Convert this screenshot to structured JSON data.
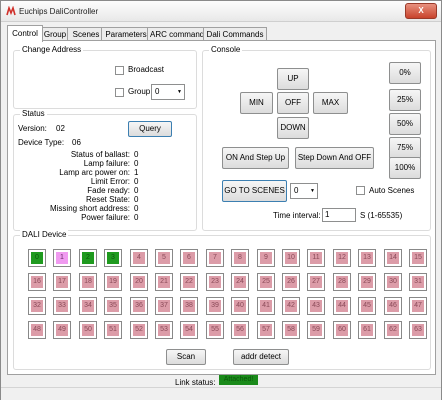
{
  "window": {
    "title": "Euchips DaliController",
    "close_label": "X"
  },
  "tabs": [
    "Control",
    "Group",
    "Scenes",
    "Parameters",
    "ARC command",
    "Dali Commands"
  ],
  "change_address": {
    "legend": "Change Address",
    "broadcast_label": "Broadcast",
    "group_label": "Group",
    "group_value": "0"
  },
  "status": {
    "legend": "Status",
    "version_label": "Version:",
    "version_value": "02",
    "device_type_label": "Device Type:",
    "device_type_value": "06",
    "query_label": "Query",
    "rows": [
      {
        "label": "Status of ballast:",
        "value": "0"
      },
      {
        "label": "Lamp failure:",
        "value": "0"
      },
      {
        "label": "Lamp arc power on:",
        "value": "1"
      },
      {
        "label": "Limit Error:",
        "value": "0"
      },
      {
        "label": "Fade ready:",
        "value": "0"
      },
      {
        "label": "Reset State:",
        "value": "0"
      },
      {
        "label": "Missing short address:",
        "value": "0"
      },
      {
        "label": "Power failure:",
        "value": "0"
      }
    ]
  },
  "console": {
    "legend": "Console",
    "up": "UP",
    "min": "MIN",
    "off": "OFF",
    "max": "MAX",
    "down": "DOWN",
    "on_step_up": "ON And Step Up",
    "step_down_off": "Step Down And OFF",
    "levels": [
      "0%",
      "25%",
      "50%",
      "75%",
      "100%"
    ],
    "go_to_scenes": "GO TO SCENES",
    "scene_value": "0",
    "auto_scenes_label": "Auto Scenes",
    "time_interval_label": "Time interval:",
    "time_interval_value": "1",
    "time_interval_unit": "S (1-65535)"
  },
  "dali": {
    "legend": "DALI Device",
    "devices": [
      "0",
      "1",
      "2",
      "3",
      "4",
      "5",
      "6",
      "7",
      "8",
      "9",
      "10",
      "11",
      "12",
      "13",
      "14",
      "15",
      "16",
      "17",
      "18",
      "19",
      "20",
      "21",
      "22",
      "23",
      "24",
      "25",
      "26",
      "27",
      "28",
      "29",
      "30",
      "31",
      "32",
      "33",
      "34",
      "35",
      "36",
      "37",
      "38",
      "39",
      "40",
      "41",
      "42",
      "43",
      "44",
      "45",
      "46",
      "47",
      "48",
      "49",
      "50",
      "51",
      "52",
      "53",
      "54",
      "55",
      "56",
      "57",
      "58",
      "59",
      "60",
      "61",
      "62",
      "63"
    ],
    "states": [
      "on",
      "sel",
      "on",
      "on",
      "off",
      "off",
      "off",
      "off",
      "off",
      "off",
      "off",
      "off",
      "off",
      "off",
      "off",
      "off",
      "off",
      "off",
      "off",
      "off",
      "off",
      "off",
      "off",
      "off",
      "off",
      "off",
      "off",
      "off",
      "off",
      "off",
      "off",
      "off",
      "off",
      "off",
      "off",
      "off",
      "off",
      "off",
      "off",
      "off",
      "off",
      "off",
      "off",
      "off",
      "off",
      "off",
      "off",
      "off",
      "off",
      "off",
      "off",
      "off",
      "off",
      "off",
      "off",
      "off",
      "off",
      "off",
      "off",
      "off",
      "off",
      "off",
      "off",
      "off"
    ],
    "colors": {
      "on": "#1f9a1f",
      "selected": "#f09af0",
      "off": "#dc9ca8"
    },
    "scan_label": "Scan",
    "addr_detect_label": "addr detect"
  },
  "link_status": {
    "label": "Link status:",
    "value": "Attached!",
    "color": "#1a8a1a"
  }
}
